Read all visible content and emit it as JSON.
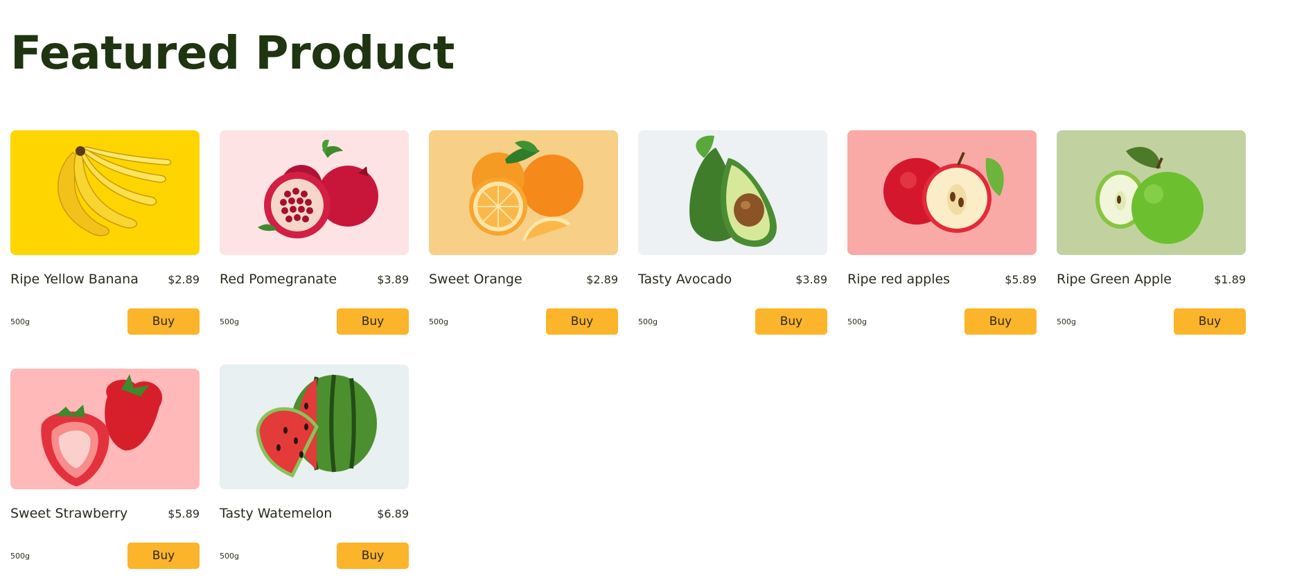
{
  "page_title": "Featured Product",
  "products": [
    {
      "name": "Ripe Yellow Banana",
      "price": "$2.89",
      "weight": "500g",
      "buy_label": "Buy",
      "image": "banana-image",
      "bg": "#ffd500"
    },
    {
      "name": "Red Pomegranate",
      "price": "$3.89",
      "weight": "500g",
      "buy_label": "Buy",
      "image": "pomegranate-image",
      "bg": "#fde3e4"
    },
    {
      "name": "Sweet Orange",
      "price": "$2.89",
      "weight": "500g",
      "buy_label": "Buy",
      "image": "orange-image",
      "bg": "#f7cf86"
    },
    {
      "name": "Tasty Avocado",
      "price": "$3.89",
      "weight": "500g",
      "buy_label": "Buy",
      "image": "avocado-image",
      "bg": "#edf1f4"
    },
    {
      "name": "Ripe red apples",
      "price": "$5.89",
      "weight": "500g",
      "buy_label": "Buy",
      "image": "red-apple-image",
      "bg": "#f9aaa6"
    },
    {
      "name": "Ripe Green Apple",
      "price": "$1.89",
      "weight": "500g",
      "buy_label": "Buy",
      "image": "green-apple-image",
      "bg": "#c1d2a0"
    },
    {
      "name": "Sweet Strawberry",
      "price": "$5.89",
      "weight": "500g",
      "buy_label": "Buy",
      "image": "strawberry-image",
      "bg": "#ffb9b9"
    },
    {
      "name": "Tasty Watemelon",
      "price": "$6.89",
      "weight": "500g",
      "buy_label": "Buy",
      "image": "watermelon-image",
      "bg": "#e8f0f1"
    }
  ],
  "colors": {
    "title": "#1f3410",
    "text": "#2a2a1e",
    "button": "#fcb42a"
  }
}
